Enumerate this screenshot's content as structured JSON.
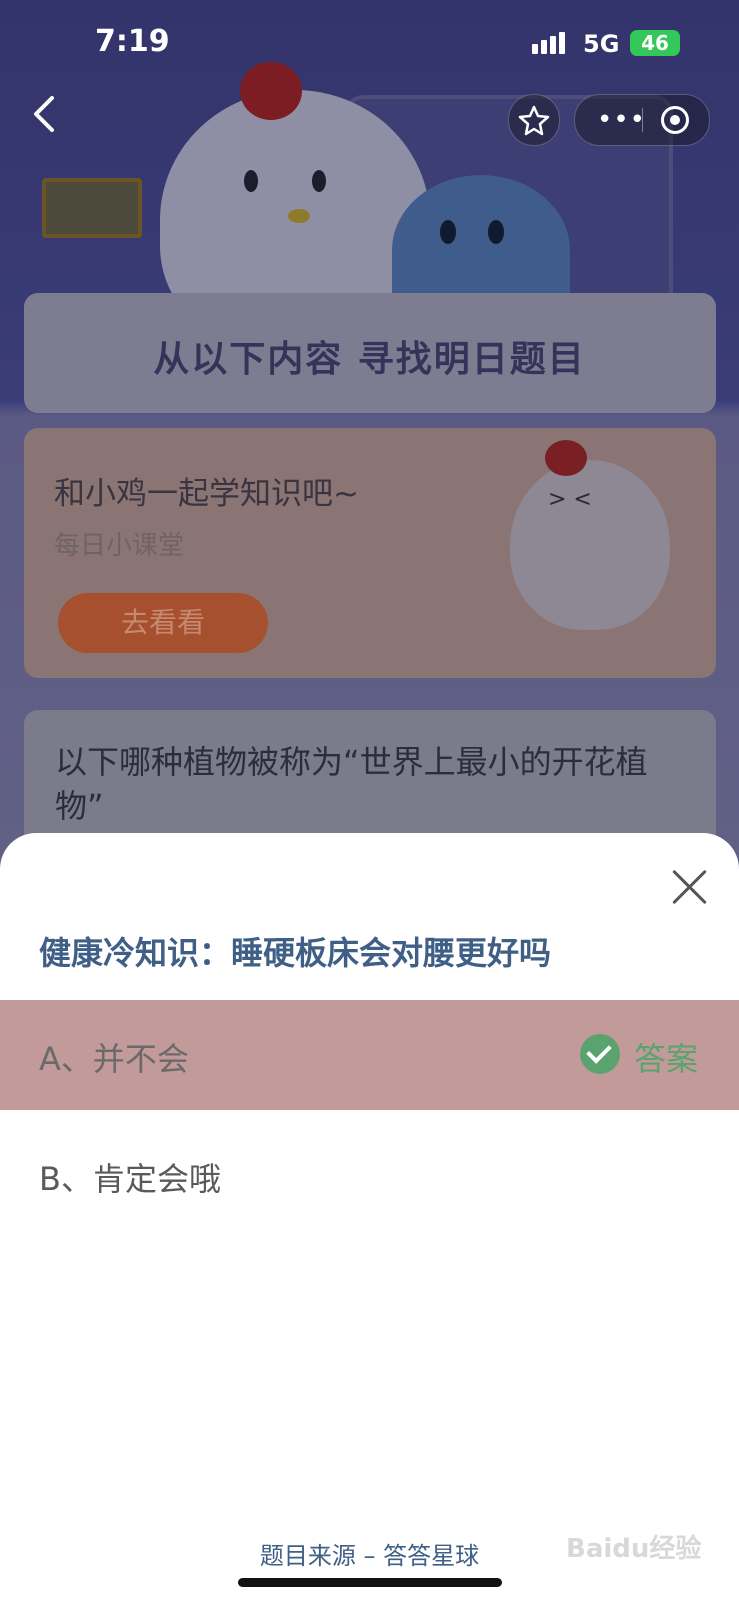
{
  "status_bar": {
    "time": "7:19",
    "network": "5G",
    "battery": "46"
  },
  "background": {
    "section_heading": "从以下内容 寻找明日题目",
    "lesson_card": {
      "title": "和小鸡一起学知识吧~",
      "subtitle": "每日小课堂",
      "button": "去看看"
    },
    "next_question": "以下哪种植物被称为“世界上最小的开花植物”"
  },
  "sheet": {
    "question": "健康冷知识：睡硬板床会对腰更好吗",
    "options": [
      {
        "label": "A、并不会",
        "is_answer": true
      },
      {
        "label": "B、肯定会哦",
        "is_answer": false
      }
    ],
    "answer_label": "答案",
    "source": "题目来源 – 答答星球",
    "watermark": "Baidu经验"
  },
  "colors": {
    "answer_highlight": "#c29a99",
    "question_text": "#3f5f86",
    "correct_green": "#5aa36f"
  },
  "icons": [
    "back-icon",
    "star-check-icon",
    "more-icon",
    "target-icon",
    "close-icon",
    "check-circle-icon"
  ]
}
